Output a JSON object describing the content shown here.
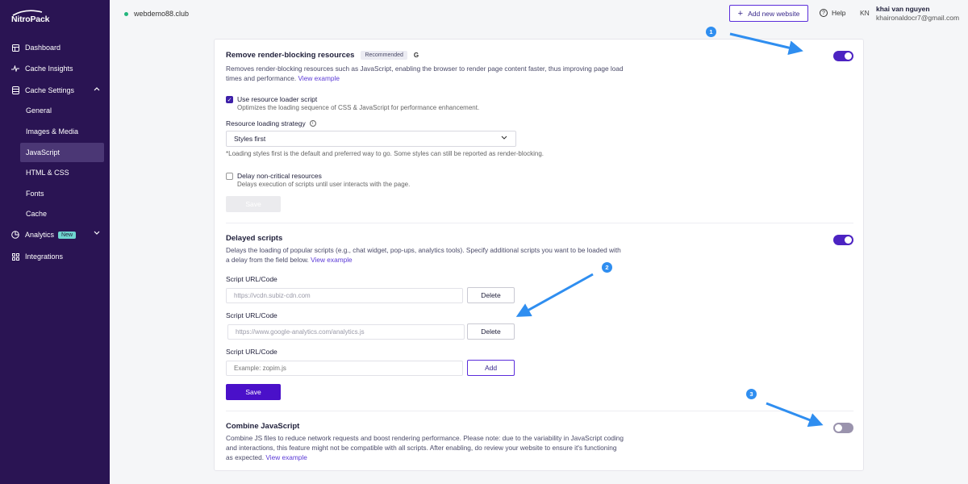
{
  "brand": {
    "name": "NitroPack"
  },
  "sidebar": {
    "items": [
      {
        "label": "Dashboard"
      },
      {
        "label": "Cache Insights"
      },
      {
        "label": "Cache Settings"
      },
      {
        "label": "General"
      },
      {
        "label": "Images & Media"
      },
      {
        "label": "JavaScript"
      },
      {
        "label": "HTML & CSS"
      },
      {
        "label": "Fonts"
      },
      {
        "label": "Cache"
      },
      {
        "label": "Analytics",
        "badge": "New"
      },
      {
        "label": "Integrations"
      }
    ]
  },
  "topbar": {
    "site": "webdemo88.club",
    "add_website": "Add new website",
    "help": "Help",
    "avatar": "KN",
    "user_name": "khai van nguyen",
    "user_email": "khaironaldocr7@gmail.com"
  },
  "render_blocking": {
    "title": "Remove render-blocking resources",
    "badge": "Recommended",
    "g_icon": "G",
    "desc_line1": "Removes render-blocking resources such as JavaScript, enabling the browser to render page content faster, thus improving page load",
    "desc_line2": "times and performance.",
    "link": "View example",
    "use_loader_label": "Use resource loader script",
    "use_loader_desc": "Optimizes the loading sequence of CSS & JavaScript for performance enhancement.",
    "strategy_label": "Resource loading strategy",
    "strategy_value": "Styles first",
    "strategy_note": "*Loading styles first is the default and preferred way to go. Some styles can still be reported as render-blocking.",
    "delay_label": "Delay non-critical resources",
    "delay_desc": "Delays execution of scripts until user interacts with the page.",
    "save": "Save"
  },
  "delayed_scripts": {
    "title": "Delayed scripts",
    "desc_line1": "Delays the loading of popular scripts (e.g., chat widget, pop-ups, analytics tools). Specify additional scripts you want to be loaded with",
    "desc_line2": "a delay from the field below.",
    "link": "View example",
    "rows": [
      {
        "label": "Script URL/Code",
        "value": "https://vcdn.subiz-cdn.com",
        "button": "Delete"
      },
      {
        "label": "Script URL/Code",
        "value": "https://www.google-analytics.com/analytics.js",
        "button": "Delete"
      },
      {
        "label": "Script URL/Code",
        "placeholder": "Example: zopim.js",
        "button": "Add"
      }
    ],
    "save": "Save"
  },
  "combine_js": {
    "title": "Combine JavaScript",
    "desc_line1": "Combine JS files to reduce network requests and boost rendering performance. Please note: due to the variability in JavaScript coding",
    "desc_line2": "and interactions, this feature might not be compatible with all scripts. After enabling, do review your website to ensure it's functioning",
    "desc_line3": "as expected.",
    "link": "View example"
  },
  "markers": [
    "1",
    "2",
    "3"
  ],
  "colors": {
    "sidebar": "#2a1453",
    "accent": "#4a10c9",
    "marker": "#2f8ef0"
  }
}
